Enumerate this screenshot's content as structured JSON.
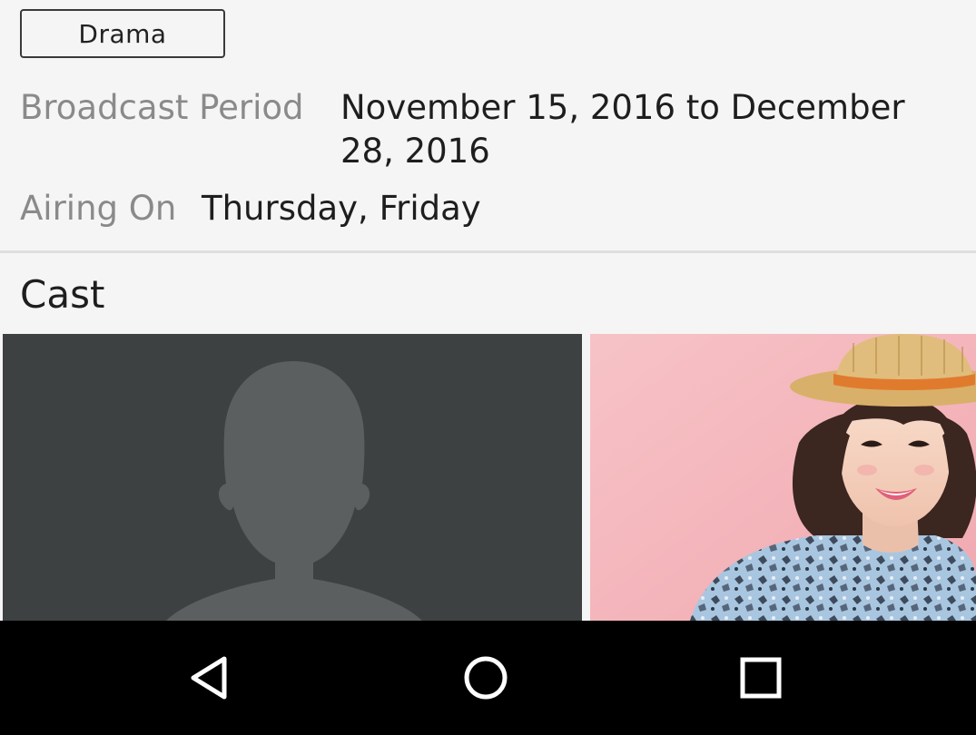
{
  "genre_tag": "Drama",
  "info": {
    "broadcast_label": "Broadcast Period",
    "broadcast_value": "November 15, 2016 to December 28, 2016",
    "airing_label": "Airing On",
    "airing_value": "Thursday, Friday"
  },
  "cast_section": {
    "title": "Cast",
    "items": [
      {
        "image": "placeholder-silhouette"
      },
      {
        "image": "actor-photo-woman-straw-hat"
      }
    ]
  },
  "nav_bar": {
    "icons": [
      "back-icon",
      "home-icon",
      "recents-icon"
    ]
  },
  "colors": {
    "background": "#f5f5f5",
    "label_gray": "#8a8a8a",
    "placeholder_bg": "#3d4142",
    "photo_bg": "#f4b8bd",
    "nav_bg": "#000000"
  }
}
